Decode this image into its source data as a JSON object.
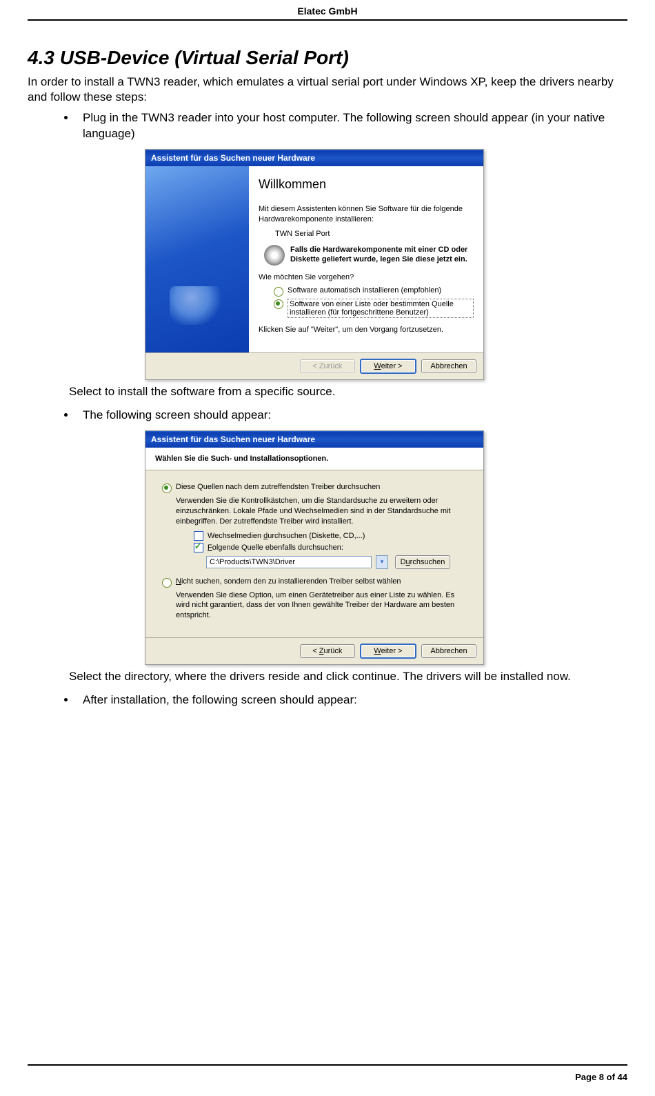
{
  "doc": {
    "header": "Elatec GmbH",
    "footer": "Page 8 of 44",
    "section_title": "4.3  USB-Device (Virtual Serial Port)",
    "intro": "In order to install a TWN3 reader, which emulates a virtual serial port under Windows XP, keep the drivers nearby and follow these steps:",
    "bullet1": "Plug in the TWN3 reader into your host computer. The following screen should appear (in your native language)",
    "after_wiz1": "Select to install the software from a specific source.",
    "bullet2": "The following screen should appear:",
    "after_wiz2": "Select the directory, where the drivers reside and click continue. The drivers will be installed now.",
    "bullet3": "After installation, the following screen should appear:"
  },
  "wiz1": {
    "title": "Assistent für das Suchen neuer Hardware",
    "heading": "Willkommen",
    "p1": "Mit diesem Assistenten können Sie Software für die folgende Hardwarekomponente installieren:",
    "device": "TWN Serial Port",
    "cd_bold": "Falls die Hardwarekomponente mit einer CD oder Diskette geliefert wurde, legen Sie diese jetzt ein.",
    "q": "Wie möchten Sie vorgehen?",
    "opt_a": "Software automatisch installieren (empfohlen)",
    "opt_b": "Software von einer Liste oder bestimmten Quelle installieren (für fortgeschrittene Benutzer)",
    "cont": "Klicken Sie auf \"Weiter\", um den Vorgang fortzusetzen.",
    "btn_back": "< Zurück",
    "btn_next": "Weiter >",
    "btn_cancel": "Abbrechen"
  },
  "wiz2": {
    "title": "Assistent für das Suchen neuer Hardware",
    "subheader": "Wählen Sie die Such- und Installationsoptionen.",
    "opt1": "Diese Quellen nach dem zutreffendsten Treiber durchsuchen",
    "opt1_sub": "Verwenden Sie die Kontrollkästchen, um die Standardsuche zu erweitern oder einzuschränken. Lokale Pfade und Wechselmedien sind in der Standardsuche mit einbegriffen. Der zutreffendste Treiber wird installiert.",
    "chk1": "Wechselmedien durchsuchen (Diskette, CD,...)",
    "chk2": "Folgende Quelle ebenfalls durchsuchen:",
    "path": "C:\\Products\\TWN3\\Driver",
    "browse": "Durchsuchen",
    "opt2": "Nicht suchen, sondern den zu installierenden Treiber selbst wählen",
    "opt2_sub": "Verwenden Sie diese Option, um einen Gerätetreiber aus einer Liste zu wählen. Es wird nicht garantiert, dass der von Ihnen gewählte Treiber der Hardware am besten entspricht.",
    "btn_back": "< Zurück",
    "btn_next": "Weiter >",
    "btn_cancel": "Abbrechen"
  }
}
